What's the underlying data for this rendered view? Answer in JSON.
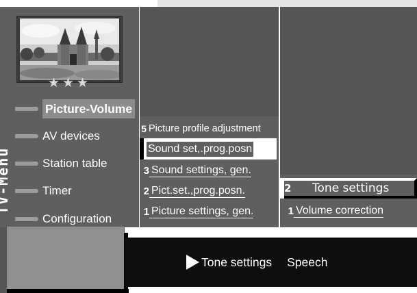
{
  "sidebar": {
    "stars": "★★★",
    "title": "TV-Menu",
    "items": [
      {
        "label": "Picture-Volume"
      },
      {
        "label": "AV devices"
      },
      {
        "label": "Station table"
      },
      {
        "label": "Timer"
      },
      {
        "label": "Configuration"
      }
    ]
  },
  "submenu": {
    "items": [
      {
        "num": "5",
        "label": "Picture profile adjustment"
      },
      {
        "num": "",
        "label": "Sound set,.prog.posn"
      },
      {
        "num": "3",
        "label": "Sound settings, gen."
      },
      {
        "num": "2",
        "label": "Pict.set.,prog.posn."
      },
      {
        "num": "1",
        "label": "Picture settings, gen."
      }
    ]
  },
  "options": {
    "items": [
      {
        "num": "2",
        "label": "Tone settings"
      },
      {
        "num": "1",
        "label": "Volume correction"
      }
    ]
  },
  "status": {
    "primary": "Tone settings",
    "secondary": "Speech"
  },
  "colors": {
    "panel": "#5f5f5f",
    "panel_dark": "#555555",
    "highlight": "#ffffff",
    "status_bar": "#0e0e0e"
  }
}
